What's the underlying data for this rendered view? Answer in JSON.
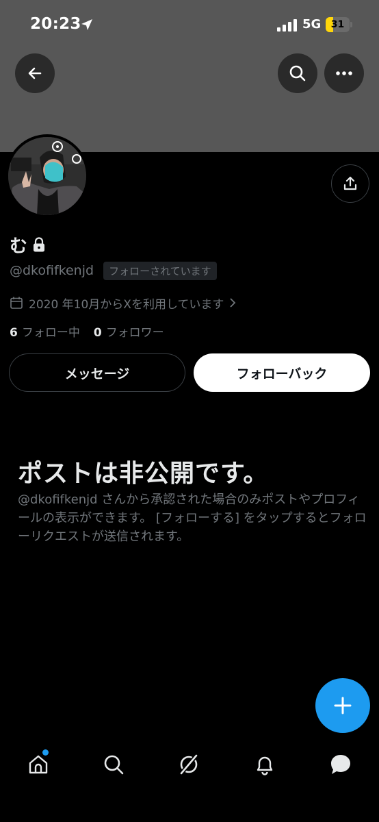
{
  "status_bar": {
    "time": "20:23",
    "network": "5G",
    "battery_level": "31",
    "battery_fraction": 0.31,
    "battery_color": "#ffd60a"
  },
  "header": {
    "back_icon": "arrow-left-icon",
    "search_icon": "search-icon",
    "more_icon": "more-horizontal-icon",
    "banner_color": "#575757"
  },
  "profile": {
    "display_name": "む",
    "handle": "@dkofifkenjd",
    "follows_you": "フォローされています",
    "joined": "2020 年10月からXを利用しています",
    "following_count": "6",
    "following_label": "フォロー中",
    "followers_count": "0",
    "followers_label": "フォロワー"
  },
  "actions": {
    "message_label": "メッセージ",
    "follow_back_label": "フォローバック"
  },
  "protected": {
    "title": "ポストは非公開です。",
    "description": "@dkofifkenjd さんから承認された場合のみポストやプロフィールの表示ができます。 [フォローする] をタップするとフォローリクエストが送信されます。"
  },
  "bottom_nav": {
    "items": [
      "home-icon",
      "search-icon",
      "grok-icon",
      "notifications-icon",
      "messages-icon"
    ],
    "accent": "#1d9bf0"
  }
}
